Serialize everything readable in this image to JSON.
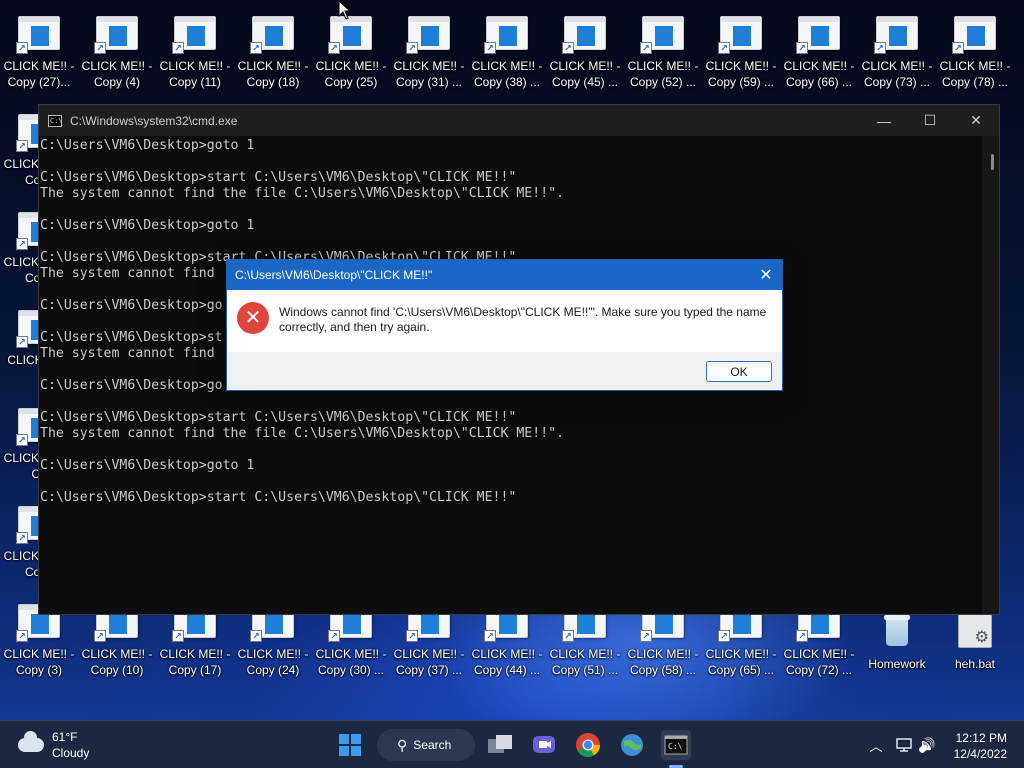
{
  "colors": {
    "accent": "#1966c4",
    "error": "#e0453b",
    "console_bg": "#0c0c0c",
    "console_text": "#cccccc"
  },
  "desktop": {
    "top_row": [
      {
        "label": "CLICK ME!! - Copy (27)..."
      },
      {
        "label": "CLICK ME!! - Copy (4)"
      },
      {
        "label": "CLICK ME!! - Copy (11)"
      },
      {
        "label": "CLICK ME!! - Copy (18)"
      },
      {
        "label": "CLICK ME!! - Copy (25)"
      },
      {
        "label": "CLICK ME!! - Copy (31) ..."
      },
      {
        "label": "CLICK ME!! - Copy (38) ..."
      },
      {
        "label": "CLICK ME!! - Copy (45) ..."
      },
      {
        "label": "CLICK ME!! - Copy (52) ..."
      },
      {
        "label": "CLICK ME!! - Copy (59) ..."
      },
      {
        "label": "CLICK ME!! - Copy (66) ..."
      },
      {
        "label": "CLICK ME!! - Copy (73) ..."
      },
      {
        "label": "CLICK ME!! - Copy (78) ..."
      }
    ],
    "left_col": [
      {
        "label": "CLICK ME!! - Copy"
      },
      {
        "label": "CLICK ME!! - Copy"
      },
      {
        "label": "CLICK ME!!"
      },
      {
        "label": "CLICK ME!! - Co"
      },
      {
        "label": "CLICK ME!! - Copy"
      }
    ],
    "bottom_row": [
      {
        "label": "CLICK ME!! - Copy (3)"
      },
      {
        "label": "CLICK ME!! - Copy (10)"
      },
      {
        "label": "CLICK ME!! - Copy (17)"
      },
      {
        "label": "CLICK ME!! - Copy (24)"
      },
      {
        "label": "CLICK ME!! - Copy (30) ..."
      },
      {
        "label": "CLICK ME!! - Copy (37) ..."
      },
      {
        "label": "CLICK ME!! - Copy (44) ..."
      },
      {
        "label": "CLICK ME!! - Copy (51) ..."
      },
      {
        "label": "CLICK ME!! - Copy (58) ..."
      },
      {
        "label": "CLICK ME!! - Copy (65) ..."
      },
      {
        "label": "CLICK ME!! - Copy (72) ..."
      }
    ],
    "recycle_bin": {
      "label": "Homework"
    },
    "bat_file": {
      "label": "heh.bat"
    }
  },
  "cmd": {
    "title": "C:\\Windows\\system32\\cmd.exe",
    "icon_text": "C:\\",
    "minimize": "—",
    "maximize": "☐",
    "close": "✕",
    "lines": [
      "C:\\Users\\VM6\\Desktop>goto 1",
      "",
      "C:\\Users\\VM6\\Desktop>start C:\\Users\\VM6\\Desktop\\\"CLICK ME!!\"",
      "The system cannot find the file C:\\Users\\VM6\\Desktop\\\"CLICK ME!!\".",
      "",
      "C:\\Users\\VM6\\Desktop>goto 1",
      "",
      "C:\\Users\\VM6\\Desktop>start C:\\Users\\VM6\\Desktop\\\"CLICK ME!!\"",
      "The system cannot find",
      "",
      "C:\\Users\\VM6\\Desktop>go",
      "",
      "C:\\Users\\VM6\\Desktop>st",
      "The system cannot find",
      "",
      "C:\\Users\\VM6\\Desktop>go",
      "",
      "C:\\Users\\VM6\\Desktop>start C:\\Users\\VM6\\Desktop\\\"CLICK ME!!\"",
      "The system cannot find the file C:\\Users\\VM6\\Desktop\\\"CLICK ME!!\".",
      "",
      "C:\\Users\\VM6\\Desktop>goto 1",
      "",
      "C:\\Users\\VM6\\Desktop>start C:\\Users\\VM6\\Desktop\\\"CLICK ME!!\""
    ]
  },
  "dialog": {
    "title": "C:\\Users\\VM6\\Desktop\\\"CLICK ME!!\"",
    "close": "✕",
    "error_glyph": "✕",
    "message": "Windows cannot find 'C:\\Users\\VM6\\Desktop\\\"CLICK ME!!\"'. Make sure you typed the name correctly, and then try again.",
    "ok_label": "OK"
  },
  "taskbar": {
    "weather_temp": "61°F",
    "weather_desc": "Cloudy",
    "search_label": "Search",
    "search_glyph": "⚲",
    "tray_chevron": "︿",
    "volume_glyph": "🔊",
    "time": "12:12 PM",
    "date": "12/4/2022"
  }
}
